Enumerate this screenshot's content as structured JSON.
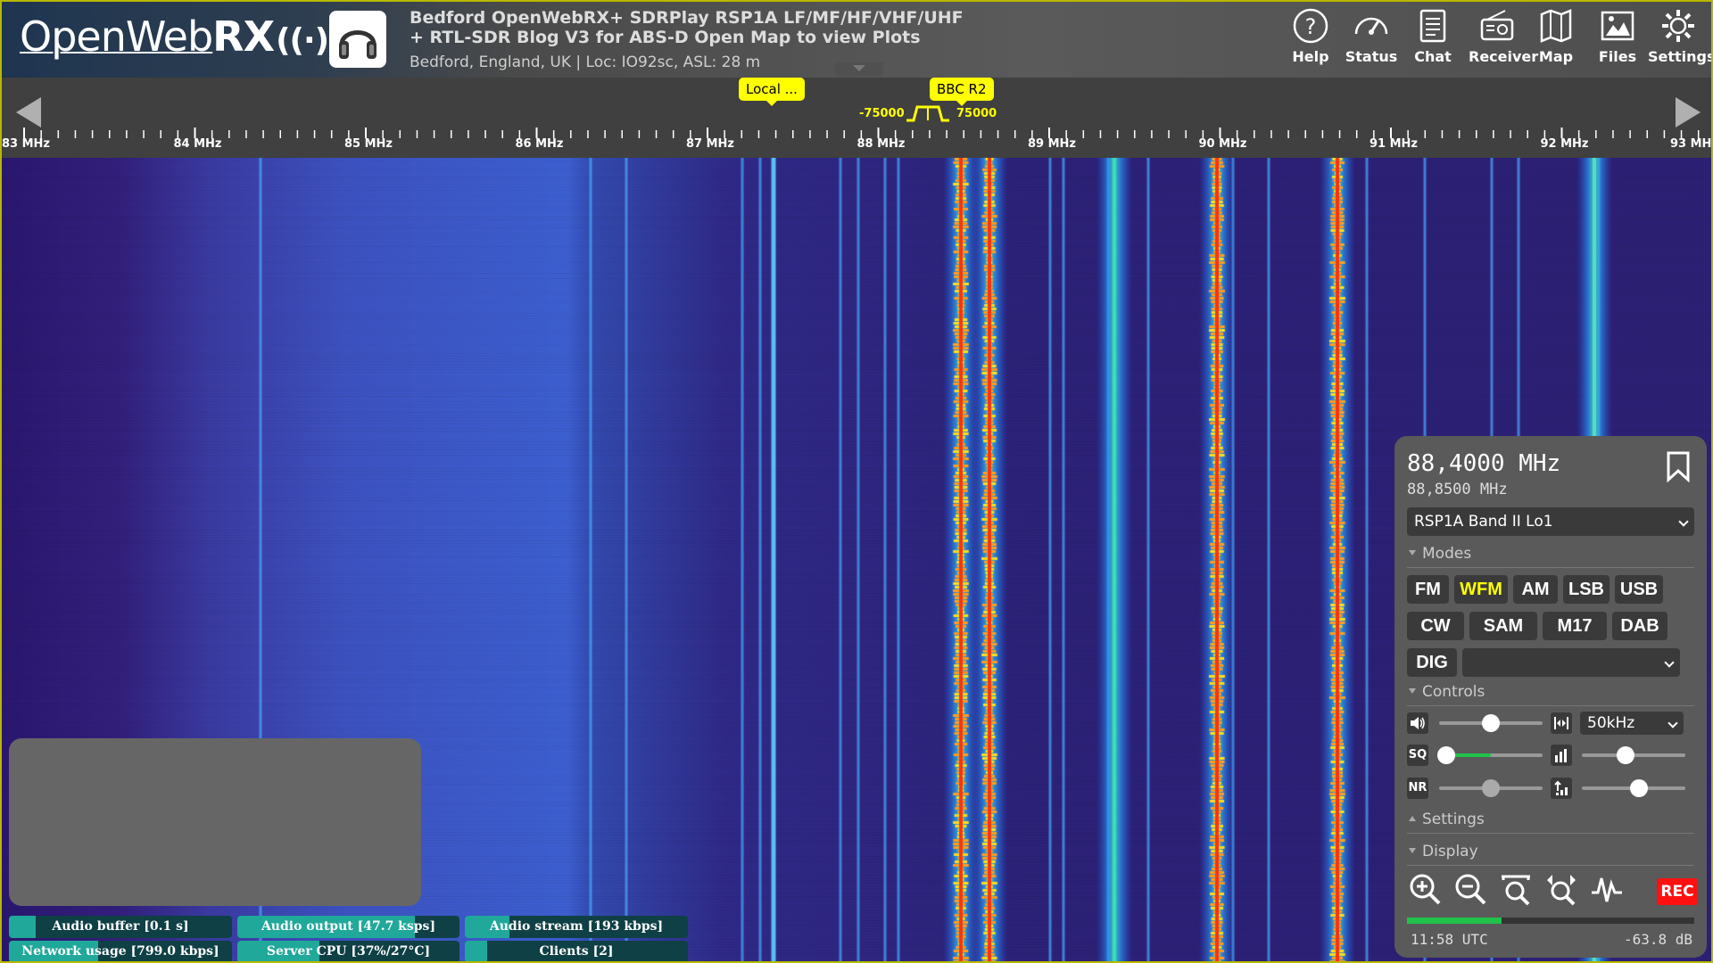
{
  "header": {
    "logo_text_thin": "Open",
    "logo_text_web": "Web",
    "logo_text_bold": "RX",
    "receiver_title_line1": "Bedford OpenWebRX+ SDRPlay RSP1A LF/MF/HF/VHF/UHF",
    "receiver_title_line2": "+ RTL-SDR Blog V3 for ABS-D Open Map to view Plots",
    "receiver_desc": "Bedford, England, UK | Loc: IO92sc, ASL: 28 m",
    "nav": [
      {
        "label": "Help",
        "icon": "help-icon"
      },
      {
        "label": "Status",
        "icon": "gauge-icon"
      },
      {
        "label": "Chat",
        "icon": "chat-icon"
      },
      {
        "label": "Receiver",
        "icon": "radio-icon"
      },
      {
        "label": "Map",
        "icon": "map-icon"
      },
      {
        "label": "Files",
        "icon": "image-icon"
      },
      {
        "label": "Settings",
        "icon": "gear-icon"
      }
    ]
  },
  "scale": {
    "bookmarks": [
      "Local ...",
      "BBC R2"
    ],
    "bandwidth_low": "-75000",
    "bandwidth_high": "75000",
    "mhz_labels": [
      "83 MHz",
      "84 MHz",
      "85 MHz",
      "86 MHz",
      "87 MHz",
      "88 MHz",
      "89 MHz",
      "90 MHz",
      "91 MHz",
      "92 MHz",
      "93 MHz"
    ]
  },
  "status": [
    {
      "label": "Audio buffer [0.1 s]",
      "fill": 0.12
    },
    {
      "label": "Audio output [47.7 ksps]",
      "fill": 0.8
    },
    {
      "label": "Audio stream [193 kbps]",
      "fill": 0.2
    },
    {
      "label": "Network usage [799.0 kbps]",
      "fill": 0.4
    },
    {
      "label": "Server CPU [37%/27°C]",
      "fill": 0.37
    },
    {
      "label": "Clients [2]",
      "fill": 0.1
    }
  ],
  "panel": {
    "frequency": "88,4000 MHz",
    "offset_frequency": "88,8500 MHz",
    "profile": "RSP1A Band II Lo1",
    "modes_heading": "Modes",
    "modes_row1": [
      "FM",
      "WFM",
      "AM",
      "LSB",
      "USB"
    ],
    "modes_row2": [
      "CW",
      "SAM",
      "M17",
      "DAB"
    ],
    "active_mode": "WFM",
    "dig_label": "DIG",
    "dig_select": "",
    "controls_heading": "Controls",
    "volume_level": 0.5,
    "step_select": "50kHz",
    "squelch_label": "SQ",
    "squelch_level": 0.07,
    "squelch_meter": 0.5,
    "agc_level": 0.42,
    "nr_label": "NR",
    "nr_level": 0.5,
    "gain_level": 0.55,
    "settings_heading": "Settings",
    "display_heading": "Display",
    "rec_label": "REC",
    "clock": "11:58 UTC",
    "level": "-63.8 dB",
    "smeter_level": 0.33
  },
  "colors": {
    "waterfall_bg": "#34207a",
    "accent_yellow": "#ffff00",
    "status_fill": "#20a89a",
    "rec_red": "#ff1010"
  }
}
